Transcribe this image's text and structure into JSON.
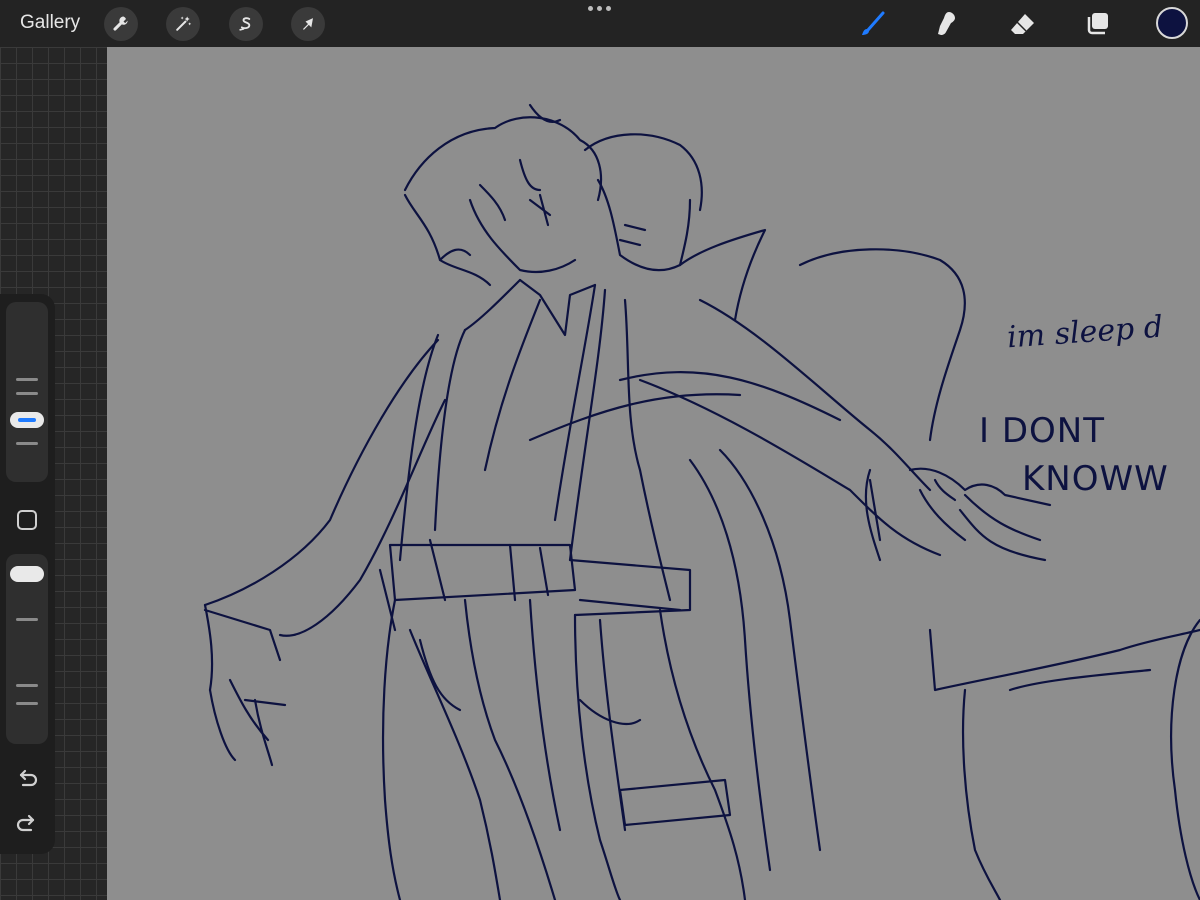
{
  "app": {
    "name": "Procreate"
  },
  "toolbar": {
    "gallery_label": "Gallery",
    "left_tools": [
      {
        "name": "actions",
        "icon": "wrench-icon"
      },
      {
        "name": "adjustments",
        "icon": "magic-wand-icon"
      },
      {
        "name": "selection",
        "icon": "selection-s-icon"
      },
      {
        "name": "transform",
        "icon": "arrow-cursor-icon"
      }
    ],
    "right_tools": [
      {
        "name": "brush",
        "icon": "brush-icon",
        "active": true
      },
      {
        "name": "smudge",
        "icon": "smudge-icon",
        "active": false
      },
      {
        "name": "eraser",
        "icon": "eraser-icon",
        "active": false
      },
      {
        "name": "layers",
        "icon": "layers-icon",
        "active": false
      }
    ],
    "current_color": "#0d1240",
    "accent_color": "#1f7bff"
  },
  "sidebar": {
    "brush_size_level": 0.55,
    "opacity_level": 0.95,
    "buttons": [
      "modify",
      "undo",
      "redo"
    ]
  },
  "canvas": {
    "background_color": "#8e8e8e",
    "stroke_color": "#0d1240",
    "notes": [
      {
        "id": "note1",
        "text": "im sleep d"
      },
      {
        "id": "note2",
        "text": "I DONT"
      },
      {
        "id": "note3",
        "text": "KNOWW"
      }
    ]
  }
}
